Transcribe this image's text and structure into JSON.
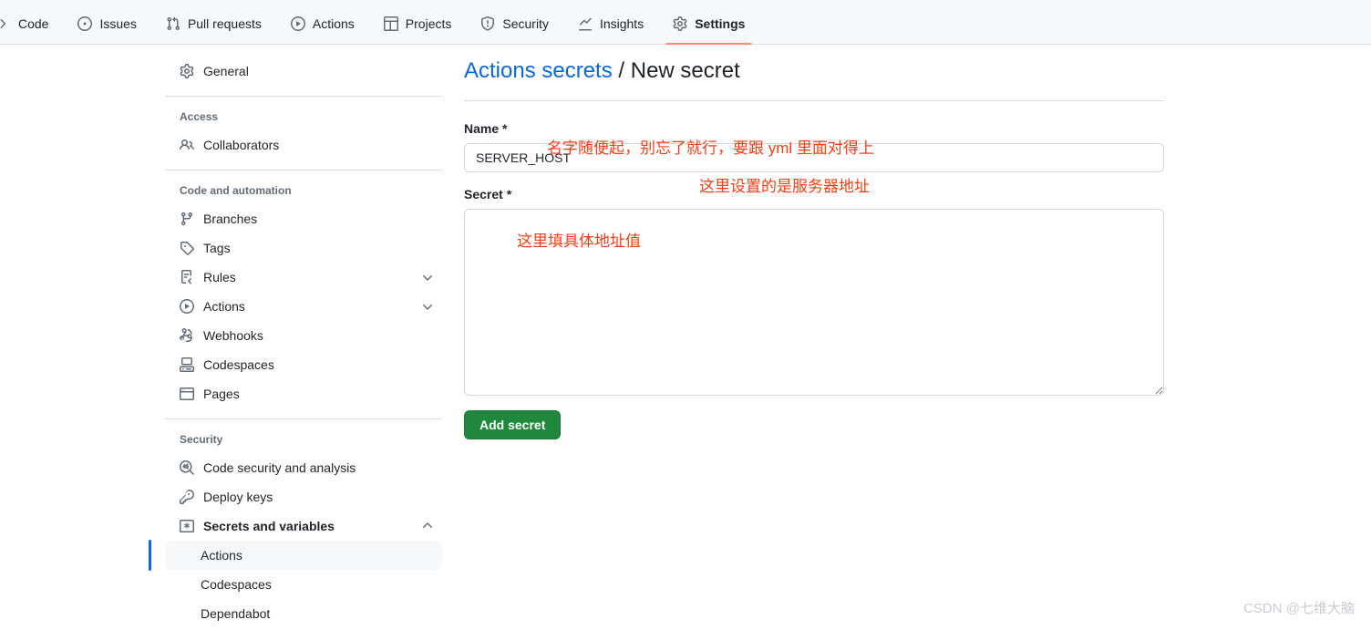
{
  "repo_nav": {
    "items": [
      {
        "label": "Code",
        "icon": "code-chevron-icon",
        "active": false
      },
      {
        "label": "Issues",
        "icon": "issue-opened-icon",
        "active": false
      },
      {
        "label": "Pull requests",
        "icon": "git-pull-request-icon",
        "active": false
      },
      {
        "label": "Actions",
        "icon": "play-circle-icon",
        "active": false
      },
      {
        "label": "Projects",
        "icon": "table-icon",
        "active": false
      },
      {
        "label": "Security",
        "icon": "shield-icon",
        "active": false
      },
      {
        "label": "Insights",
        "icon": "graph-icon",
        "active": false
      },
      {
        "label": "Settings",
        "icon": "gear-icon",
        "active": true
      }
    ],
    "active_underline_color": "#fd8c73"
  },
  "sidebar": {
    "general": {
      "label": "General",
      "icon": "gear-icon"
    },
    "groups": [
      {
        "title": "Access",
        "items": [
          {
            "label": "Collaborators",
            "icon": "people-icon",
            "expandable": false
          }
        ]
      },
      {
        "title": "Code and automation",
        "items": [
          {
            "label": "Branches",
            "icon": "git-branch-icon",
            "expandable": false
          },
          {
            "label": "Tags",
            "icon": "tag-icon",
            "expandable": false
          },
          {
            "label": "Rules",
            "icon": "rules-icon",
            "expandable": true
          },
          {
            "label": "Actions",
            "icon": "play-circle-icon",
            "expandable": true
          },
          {
            "label": "Webhooks",
            "icon": "webhook-icon",
            "expandable": false
          },
          {
            "label": "Codespaces",
            "icon": "codespaces-icon",
            "expandable": false
          },
          {
            "label": "Pages",
            "icon": "browser-icon",
            "expandable": false
          }
        ]
      },
      {
        "title": "Security",
        "items": [
          {
            "label": "Code security and analysis",
            "icon": "codescan-icon",
            "expandable": false
          },
          {
            "label": "Deploy keys",
            "icon": "key-icon",
            "expandable": false
          },
          {
            "label": "Secrets and variables",
            "icon": "asterisk-box-icon",
            "expandable": true,
            "expanded": true,
            "bold": true
          }
        ]
      }
    ],
    "secrets_subitems": [
      {
        "label": "Actions",
        "selected": true
      },
      {
        "label": "Codespaces",
        "selected": false
      },
      {
        "label": "Dependabot",
        "selected": false
      }
    ],
    "selected_accent_color": "#0969da"
  },
  "main": {
    "heading": {
      "link_text": "Actions secrets",
      "separator": " / ",
      "current": "New secret"
    },
    "name_field": {
      "label": "Name *",
      "value": "SERVER_HOST",
      "placeholder": ""
    },
    "secret_field": {
      "label": "Secret *",
      "value": "",
      "placeholder": ""
    },
    "submit_button": {
      "label": "Add secret",
      "color": "#1f883d"
    }
  },
  "annotations": {
    "color": "#fa3c14",
    "name_note": "名字随便起，别忘了就行，要跟 yml 里面对得上",
    "secret_note": "这里设置的是服务器地址",
    "value_note": "这里填具体地址值"
  },
  "watermark": {
    "text": "CSDN @七维大脑"
  }
}
